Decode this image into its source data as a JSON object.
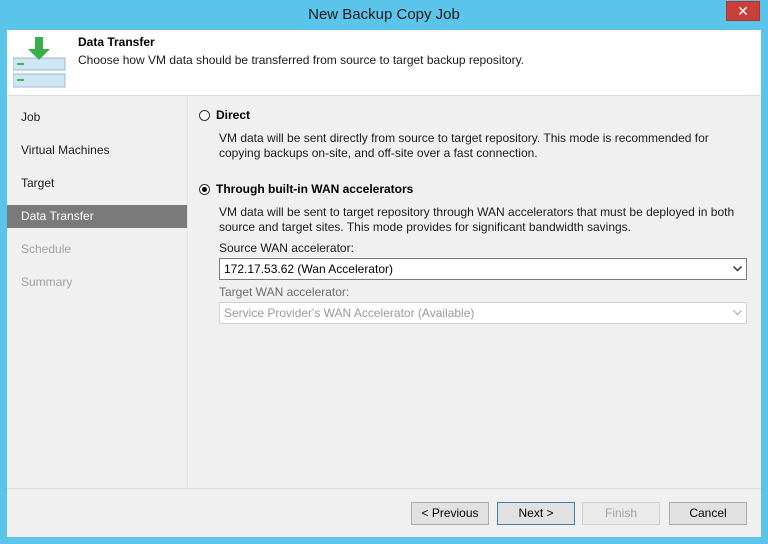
{
  "window": {
    "title": "New Backup Copy Job",
    "close_glyph": "✕",
    "accent_color": "#5bc4ea"
  },
  "header": {
    "icon": "data-transfer-icon",
    "title": "Data Transfer",
    "description": "Choose how VM data should be transferred from source to target backup repository."
  },
  "sidebar": {
    "items": [
      {
        "label": "Job",
        "state": "normal"
      },
      {
        "label": "Virtual Machines",
        "state": "normal"
      },
      {
        "label": "Target",
        "state": "normal"
      },
      {
        "label": "Data Transfer",
        "state": "active"
      },
      {
        "label": "Schedule",
        "state": "disabled"
      },
      {
        "label": "Summary",
        "state": "disabled"
      }
    ]
  },
  "content": {
    "direct": {
      "label": "Direct",
      "selected": false,
      "description": "VM data will be sent directly from source to target repository. This mode is recommended for copying backups on-site, and off-site over a fast connection."
    },
    "wan": {
      "label": "Through built-in WAN accelerators",
      "selected": true,
      "description": "VM data will be sent to target repository through WAN accelerators that must be deployed in both source and target sites. This mode provides for significant bandwidth savings."
    },
    "source_wan": {
      "label": "Source WAN accelerator:",
      "value": "172.17.53.62 (Wan Accelerator)"
    },
    "target_wan": {
      "label": "Target WAN accelerator:",
      "value": "Service Provider's WAN Accelerator (Available)"
    }
  },
  "footer": {
    "previous": "< Previous",
    "next": "Next >",
    "finish": "Finish",
    "cancel": "Cancel"
  }
}
